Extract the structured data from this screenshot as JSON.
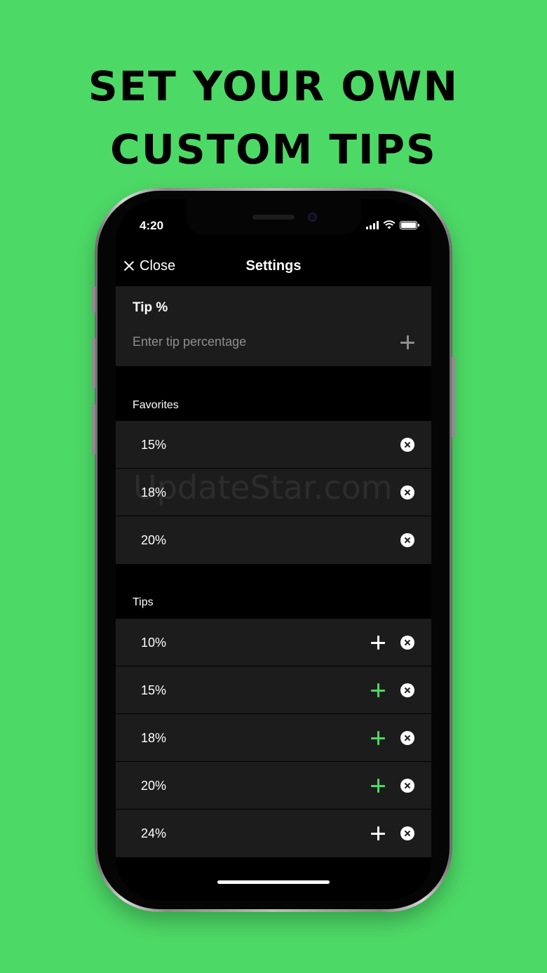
{
  "headline": {
    "line1": "SET YOUR OWN",
    "line2": "CUSTOM TIPS"
  },
  "status_bar": {
    "time": "4:20",
    "signal_icon": "cellular-signal-icon",
    "wifi_icon": "wifi-icon",
    "battery_icon": "battery-icon"
  },
  "nav": {
    "close_label": "Close",
    "title": "Settings"
  },
  "tip_entry": {
    "label": "Tip %",
    "placeholder": "Enter tip percentage",
    "value": ""
  },
  "favorites": {
    "header": "Favorites",
    "items": [
      {
        "label": "15%"
      },
      {
        "label": "18%"
      },
      {
        "label": "20%"
      }
    ]
  },
  "tips": {
    "header": "Tips",
    "items": [
      {
        "label": "10%",
        "add_color": "#ffffff"
      },
      {
        "label": "15%",
        "add_color": "#4cd964"
      },
      {
        "label": "18%",
        "add_color": "#4cd964"
      },
      {
        "label": "20%",
        "add_color": "#4cd964"
      },
      {
        "label": "24%",
        "add_color": "#ffffff"
      }
    ]
  },
  "watermark": "UpdateStar.com",
  "colors": {
    "background": "#4dd966",
    "accent_green": "#4cd964",
    "card": "#1c1c1c"
  }
}
